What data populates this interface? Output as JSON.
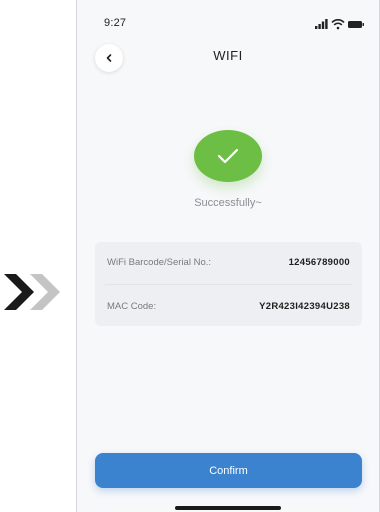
{
  "status_bar": {
    "time": "9:27",
    "icons": [
      "signal-icon",
      "wifi-icon",
      "battery-icon"
    ]
  },
  "nav": {
    "back_icon": "chevron-left-icon",
    "title": "WIFI"
  },
  "success": {
    "icon": "checkmark-icon",
    "message": "Successfully~",
    "color": "#6cbe45"
  },
  "info": {
    "rows": [
      {
        "label": "WiFi Barcode/Serial No.:",
        "value": "12456789000"
      },
      {
        "label": "MAC Code:",
        "value": "Y2R423I42394U238"
      }
    ]
  },
  "confirm": {
    "label": "Confirm",
    "color": "#3b82cf"
  },
  "decor": {
    "arrow_icon": "double-chevron-right-icon"
  }
}
